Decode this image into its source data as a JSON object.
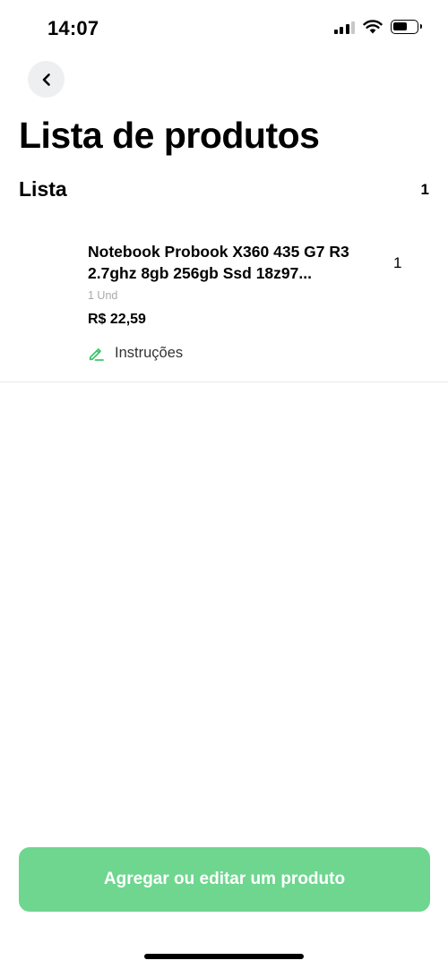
{
  "status_bar": {
    "time": "14:07",
    "icons": [
      "signal-icon",
      "wifi-icon",
      "battery-icon"
    ]
  },
  "header": {
    "back_icon": "chevron-left-icon",
    "title": "Lista de produtos"
  },
  "list": {
    "title": "Lista",
    "count": "1",
    "items": [
      {
        "name": "Notebook Probook X360 435 G7 R3 2.7ghz 8gb 256gb Ssd 18z97...",
        "quantity": "1",
        "unit": "1 Und",
        "price": "R$ 22,59",
        "instructions_label": "Instruções",
        "instructions_icon": "pencil-icon"
      }
    ]
  },
  "footer": {
    "primary_button_label": "Agregar ou editar um produto"
  },
  "colors": {
    "accent": "#6ed68f",
    "icon_accent": "#3fc46b",
    "back_button_bg": "#eeeff1"
  }
}
